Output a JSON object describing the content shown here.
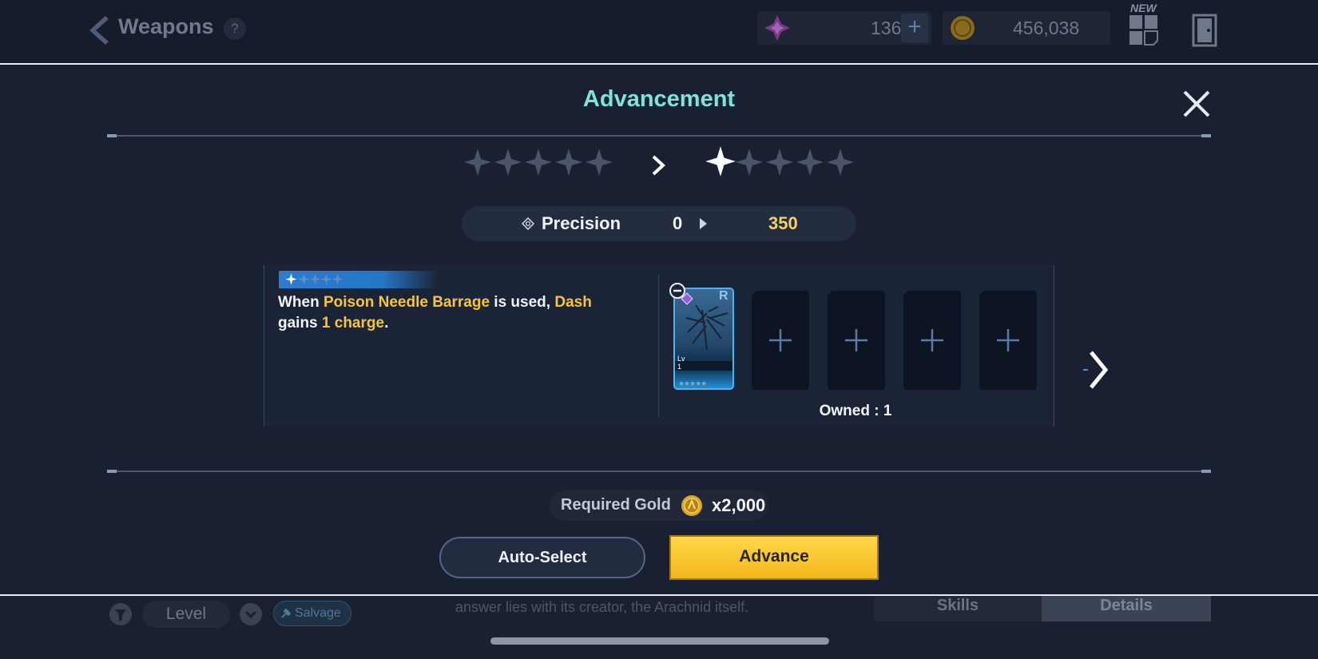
{
  "header": {
    "title": "Weapons",
    "help": "?",
    "gems": "136",
    "gems_plus": "+",
    "gold": "456,038",
    "new_badge": "NEW"
  },
  "modal": {
    "title": "Advancement",
    "current_stars": 0,
    "next_stars": 1,
    "max_stars": 5,
    "stat": {
      "name": "Precision",
      "from": "0",
      "to": "350"
    },
    "effect": {
      "tier_stars": 1,
      "part1": "When ",
      "hl1": "Poison Needle Barrage",
      "part2": " is used, ",
      "hl2": "Dash",
      "part3": " gains ",
      "hl3": "1 charge",
      "part4": "."
    },
    "material_card": {
      "rarity": "R",
      "lv_label": "Lv",
      "lv_value": "1",
      "stars": "★★★★★"
    },
    "empty_slots": 4,
    "owned": "Owned : 1",
    "required_gold_label": "Required Gold",
    "required_gold_amount": "x2,000",
    "auto_select_label": "Auto-Select",
    "advance_label": "Advance"
  },
  "footer": {
    "level_label": "Level",
    "salvage_label": "Salvage",
    "lore": "answer lies with its creator, the Arachnid itself.",
    "tab_skills": "Skills",
    "tab_details": "Details"
  },
  "colors": {
    "title_teal": "#7fe3d8",
    "highlight_gold": "#f5c53b",
    "advance_yellow": "#f3b81c",
    "star_inactive": "#4c5568"
  },
  "icons": [
    "back-arrow-icon",
    "help-icon",
    "gem-icon",
    "plus-icon",
    "gold-coin-icon",
    "grid-icon",
    "door-icon",
    "close-icon",
    "star-icon",
    "chevron-right-icon",
    "precision-icon",
    "minus-icon",
    "filter-icon",
    "sort-icon",
    "salvage-icon"
  ]
}
